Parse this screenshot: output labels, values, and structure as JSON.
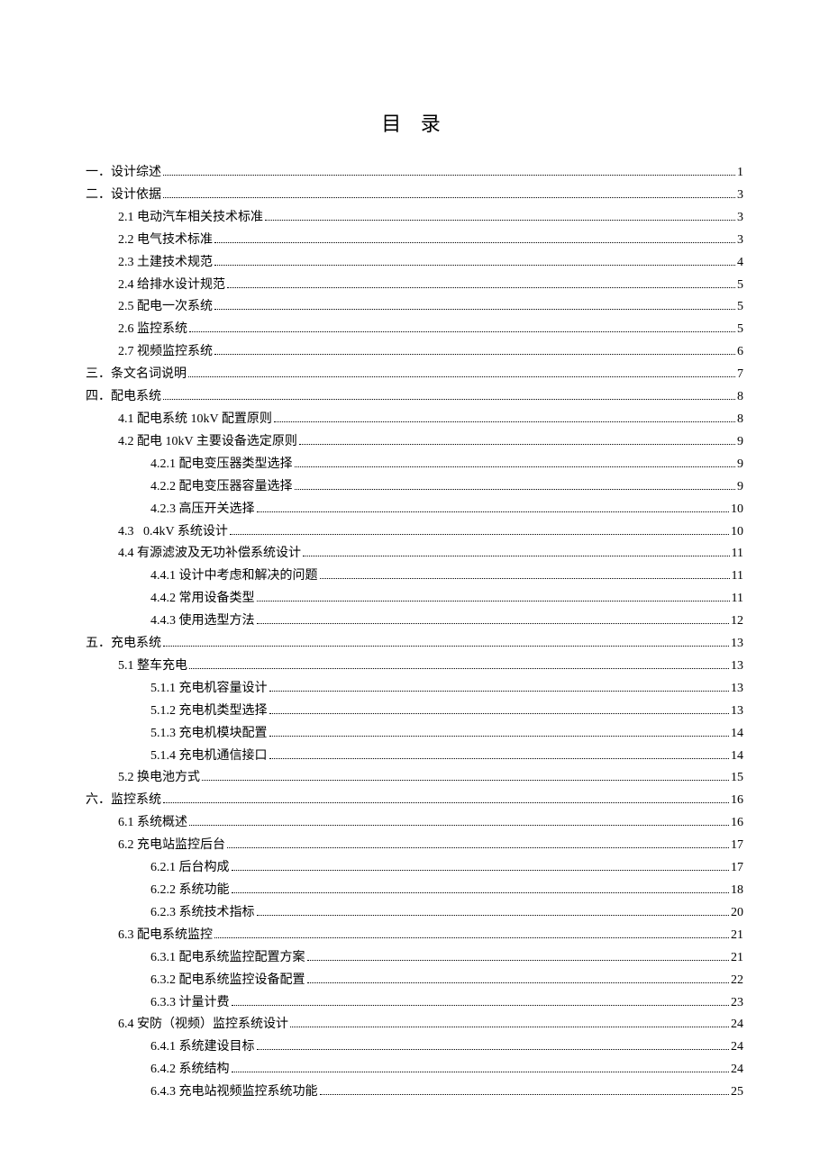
{
  "title": "目 录",
  "entries": [
    {
      "level": 0,
      "label": "一．设计综述",
      "page": "1"
    },
    {
      "level": 0,
      "label": "二．设计依据",
      "page": "3"
    },
    {
      "level": 1,
      "label": "2.1 电动汽车相关技术标准",
      "page": "3"
    },
    {
      "level": 1,
      "label": "2.2 电气技术标准",
      "page": "3"
    },
    {
      "level": 1,
      "label": "2.3 土建技术规范",
      "page": "4"
    },
    {
      "level": 1,
      "label": "2.4 给排水设计规范",
      "page": "5"
    },
    {
      "level": 1,
      "label": "2.5 配电一次系统",
      "page": "5"
    },
    {
      "level": 1,
      "label": "2.6 监控系统",
      "page": "5"
    },
    {
      "level": 1,
      "label": "2.7 视频监控系统",
      "page": "6"
    },
    {
      "level": 0,
      "label": "三．条文名词说明",
      "page": "7"
    },
    {
      "level": 0,
      "label": "四．配电系统",
      "page": "8"
    },
    {
      "level": 1,
      "label": "4.1 配电系统 10kV 配置原则",
      "page": "8"
    },
    {
      "level": 1,
      "label": "4.2 配电 10kV 主要设备选定原则",
      "page": "9"
    },
    {
      "level": 2,
      "label": "4.2.1 配电变压器类型选择",
      "page": "9"
    },
    {
      "level": 2,
      "label": "4.2.2 配电变压器容量选择",
      "page": "9"
    },
    {
      "level": 2,
      "label": "4.2.3 高压开关选择",
      "page": "10"
    },
    {
      "level": 1,
      "label": "4.3   0.4kV 系统设计",
      "page": "10"
    },
    {
      "level": 1,
      "label": "4.4 有源滤波及无功补偿系统设计",
      "page": "11"
    },
    {
      "level": 2,
      "label": "4.4.1 设计中考虑和解决的问题",
      "page": "11"
    },
    {
      "level": 2,
      "label": "4.4.2 常用设备类型",
      "page": "11"
    },
    {
      "level": 2,
      "label": "4.4.3 使用选型方法",
      "page": "12"
    },
    {
      "level": 0,
      "label": "五．充电系统",
      "page": "13"
    },
    {
      "level": 1,
      "label": "5.1 整车充电",
      "page": "13"
    },
    {
      "level": 2,
      "label": "5.1.1 充电机容量设计",
      "page": "13"
    },
    {
      "level": 2,
      "label": "5.1.2 充电机类型选择",
      "page": "13"
    },
    {
      "level": 2,
      "label": "5.1.3 充电机模块配置",
      "page": "14"
    },
    {
      "level": 2,
      "label": "5.1.4 充电机通信接口",
      "page": "14"
    },
    {
      "level": 1,
      "label": "5.2 换电池方式",
      "page": "15"
    },
    {
      "level": 0,
      "label": "六．监控系统",
      "page": "16"
    },
    {
      "level": 1,
      "label": "6.1 系统概述",
      "page": "16"
    },
    {
      "level": 1,
      "label": "6.2 充电站监控后台",
      "page": "17"
    },
    {
      "level": 2,
      "label": "6.2.1 后台构成",
      "page": "17"
    },
    {
      "level": 2,
      "label": "6.2.2 系统功能",
      "page": "18"
    },
    {
      "level": 2,
      "label": "6.2.3 系统技术指标",
      "page": "20"
    },
    {
      "level": 1,
      "label": "6.3 配电系统监控",
      "page": "21"
    },
    {
      "level": 2,
      "label": "6.3.1 配电系统监控配置方案",
      "page": "21"
    },
    {
      "level": 2,
      "label": "6.3.2 配电系统监控设备配置",
      "page": "22"
    },
    {
      "level": 2,
      "label": "6.3.3 计量计费",
      "page": "23"
    },
    {
      "level": 1,
      "label": "6.4 安防（视频）监控系统设计",
      "page": "24"
    },
    {
      "level": 2,
      "label": "6.4.1 系统建设目标",
      "page": "24"
    },
    {
      "level": 2,
      "label": "6.4.2 系统结构",
      "page": "24"
    },
    {
      "level": 2,
      "label": "6.4.3 充电站视频监控系统功能",
      "page": "25"
    }
  ]
}
